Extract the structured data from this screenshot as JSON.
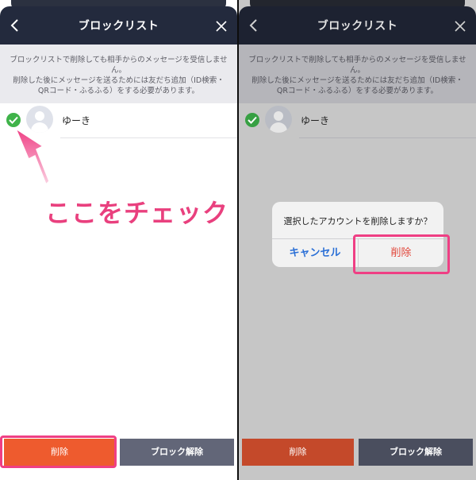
{
  "header": {
    "title": "ブロックリスト"
  },
  "notice": {
    "text": "ブロックリストで削除しても相手からのメッセージを受信しません。\n削除した後にメッセージを送るためには友だち追加（ID検索・QRコード・ふるふる）をする必要があります。"
  },
  "contact": {
    "name": "ゆーき"
  },
  "buttons": {
    "delete_label": "削除",
    "unblock_label": "ブロック解除"
  },
  "annotation": {
    "callout": "ここをチェック"
  },
  "dialog": {
    "message": "選択したアカウントを削除しますか？",
    "cancel_label": "キャンセル",
    "confirm_label": "削除"
  },
  "colors": {
    "header_bg": "#232a3d",
    "check_green": "#3fb34a",
    "delete_orange": "#ee5b2e",
    "unblock_gray": "#626678",
    "highlight_pink": "#ef3f84",
    "dialog_cancel_blue": "#2a6fd6",
    "dialog_delete_red": "#e1463a"
  },
  "icons": {
    "back": "chevron-left-icon",
    "close": "close-icon",
    "check": "check-circle-icon",
    "avatar": "default-avatar-icon"
  }
}
